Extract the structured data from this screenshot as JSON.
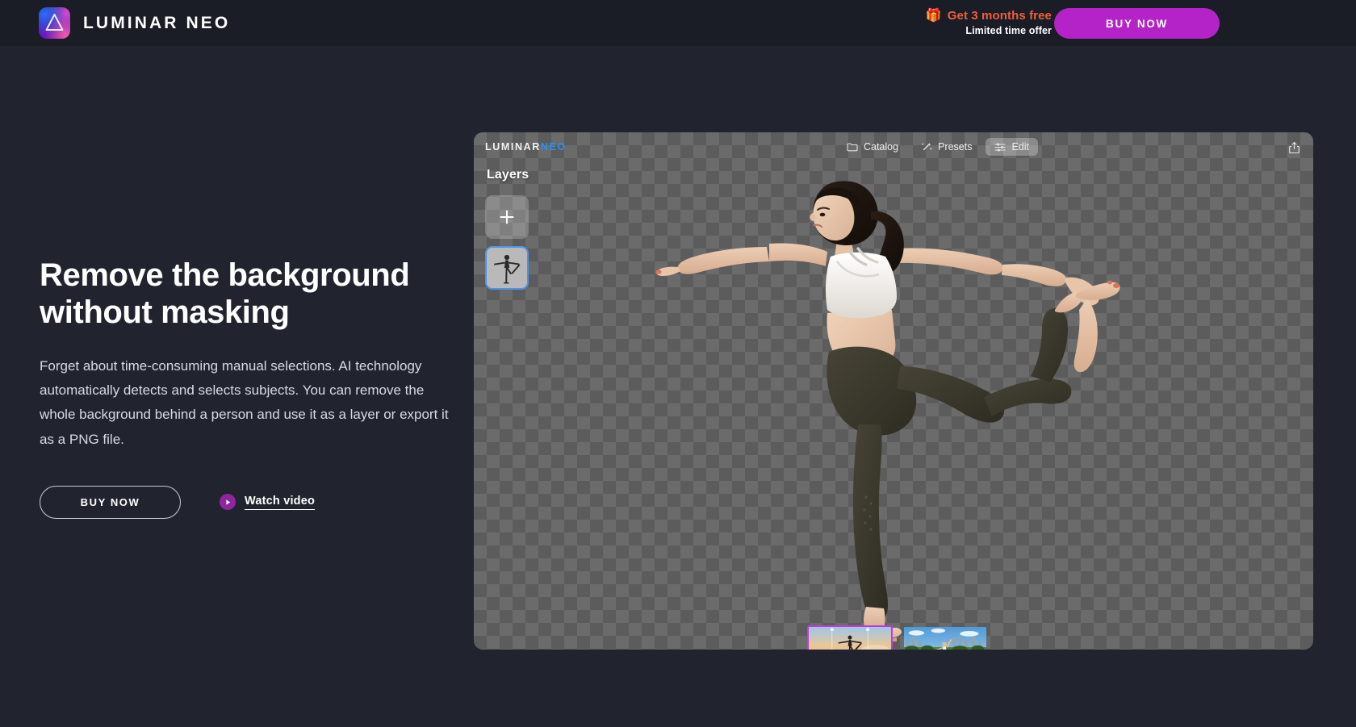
{
  "header": {
    "brand_name": "LUMINAR NEO",
    "logo_icon": "luminar-triangle-logo",
    "promo_gift_icon": "🎁",
    "promo_headline": "Get 3 months free",
    "promo_subline": "Limited time offer",
    "buy_now_label": "BUY NOW",
    "accent_promo_color": "#ef5f3c",
    "accent_buy_color": "#b423c8",
    "bar_background": "#1a1c26"
  },
  "hero": {
    "title": "Remove the background without masking",
    "body": "Forget about time-consuming manual selections. AI technology automatically detects and selects subjects. You can remove the whole background behind a person and use it as a layer or export it as a PNG file.",
    "buy_now_label": "BUY NOW",
    "watch_video_label": "Watch video",
    "play_icon": "play-icon",
    "play_button_color": "#90269f"
  },
  "app": {
    "brand_primary": "LUMINAR",
    "brand_secondary": "NEO",
    "brand_secondary_color": "#2f8fef",
    "tabs": [
      {
        "label": "Catalog",
        "icon": "folder-icon",
        "active": false
      },
      {
        "label": "Presets",
        "icon": "magic-wand-icon",
        "active": false
      },
      {
        "label": "Edit",
        "icon": "sliders-icon",
        "active": true
      }
    ],
    "share_icon": "share-export-icon",
    "layers": {
      "title": "Layers",
      "add_icon": "plus-icon",
      "add_label": "+",
      "thumbnails": [
        {
          "name": "layer-yoga-subject",
          "selected": true,
          "selection_color": "#4e93e8"
        }
      ]
    },
    "canvas": {
      "transparency_checkerboard": true,
      "checker_light": "#6b6b6b",
      "checker_dark": "#5c5c5c",
      "subject_description": "woman in dancer yoga pose, white sports bra, dark olive leggings, background removed"
    },
    "filmstrip": [
      {
        "name": "thumbnail-yoga-sunset",
        "selected": true,
        "selection_color": "#c43ad6",
        "description": "woman in dancer pose against sunset sky"
      },
      {
        "name": "thumbnail-park-stretch",
        "selected": false,
        "description": "man stretching in green park with city skyline"
      }
    ]
  },
  "page": {
    "background": "#21242e"
  }
}
